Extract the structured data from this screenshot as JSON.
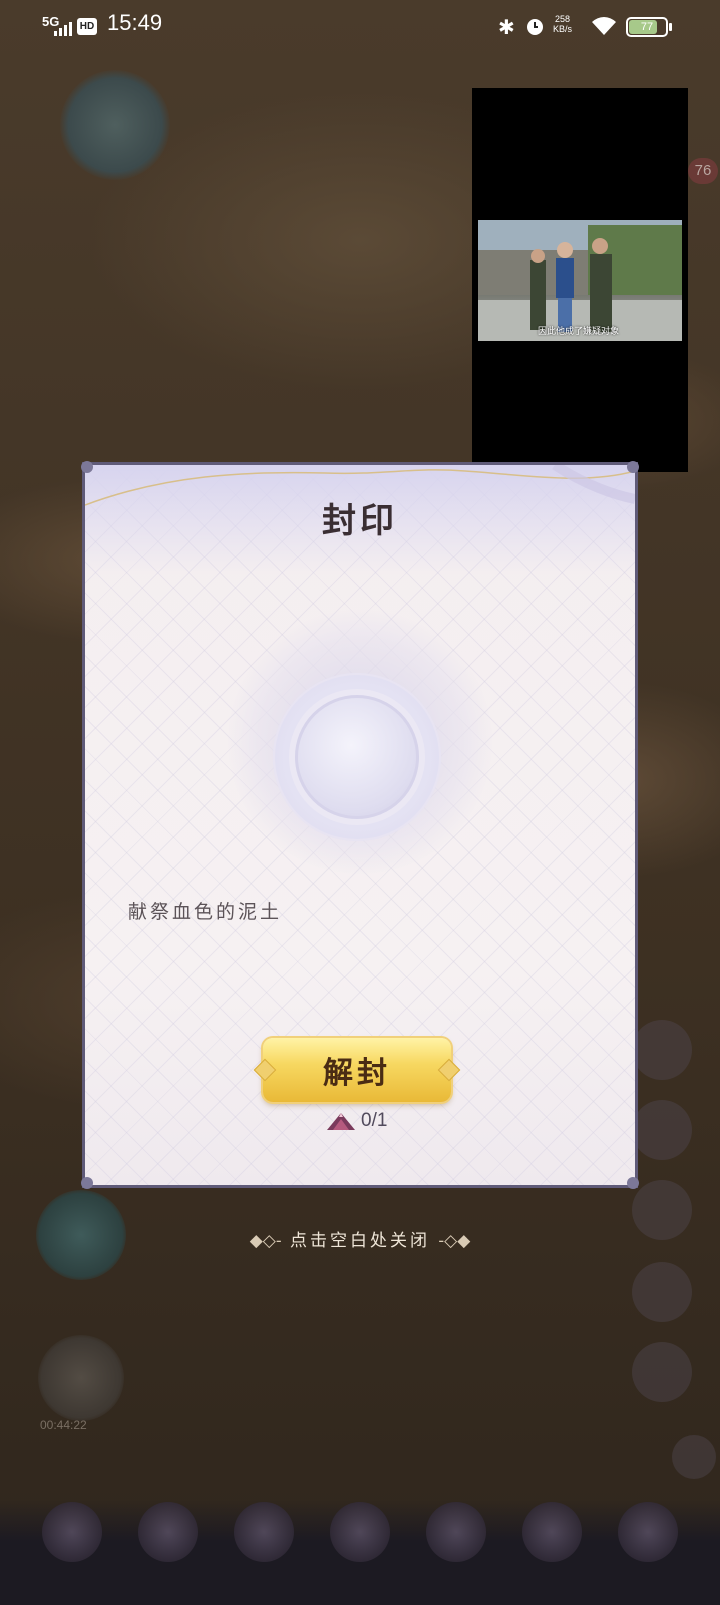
{
  "status_bar": {
    "network": "5G",
    "hd": "HD",
    "time": "15:49",
    "speed_value": "258",
    "speed_unit": "KB/s",
    "battery": "77",
    "battery_level": 0.77
  },
  "pip_video": {
    "subtitle": "因此他成了嫌疑对象"
  },
  "dialog": {
    "title": "封印",
    "offer_text": "献祭血色的泥土",
    "unseal_label": "解封",
    "cost": "0/1"
  },
  "close_hint": {
    "text": "点击空白处关闭"
  },
  "background": {
    "badge": "76",
    "timer": "00:44:22"
  },
  "colors": {
    "dialog_border": "#5f5a78",
    "button_gold": "#f7d861",
    "title_text": "#3a2e33"
  }
}
